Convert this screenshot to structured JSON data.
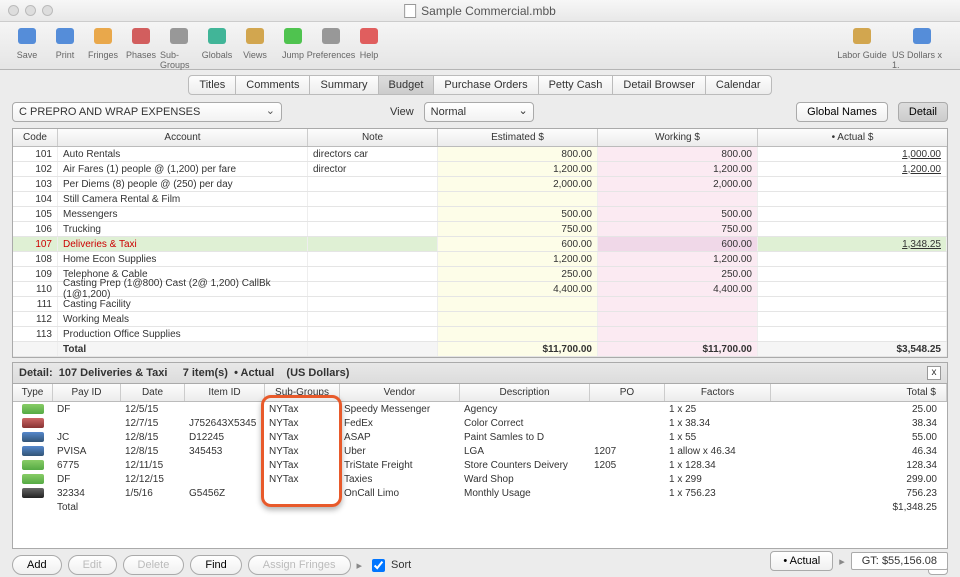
{
  "window": {
    "title": "Sample Commercial.mbb"
  },
  "toolbar": [
    {
      "label": "Save",
      "name": "save"
    },
    {
      "label": "Print",
      "name": "print"
    },
    {
      "label": "Fringes",
      "name": "fringes"
    },
    {
      "label": "Phases",
      "name": "phases"
    },
    {
      "label": "Sub-Groups",
      "name": "subgroups"
    },
    {
      "label": "Globals",
      "name": "globals"
    },
    {
      "label": "Views",
      "name": "views"
    },
    {
      "label": "Jump",
      "name": "jump"
    },
    {
      "label": "Preferences",
      "name": "prefs"
    },
    {
      "label": "Help",
      "name": "help"
    }
  ],
  "toolbar_right": [
    {
      "label": "Labor Guide",
      "name": "laborguide"
    },
    {
      "label": "US Dollars x 1.",
      "name": "currency"
    }
  ],
  "tabs": [
    "Titles",
    "Comments",
    "Summary",
    "Budget",
    "Purchase Orders",
    "Petty Cash",
    "Detail Browser",
    "Calendar"
  ],
  "active_tab": "Budget",
  "category_dropdown": "C  PREPRO AND WRAP EXPENSES",
  "view_label": "View",
  "view_value": "Normal",
  "right_buttons": {
    "global_names": "Global Names",
    "detail": "Detail"
  },
  "columns": {
    "code": "Code",
    "account": "Account",
    "note": "Note",
    "est": "Estimated $",
    "work": "Working $",
    "act": "• Actual $"
  },
  "rows": [
    {
      "code": "101",
      "acct": "Auto Rentals",
      "note": "directors car",
      "est": "800.00",
      "work": "800.00",
      "act": "1,000.00",
      "actU": true
    },
    {
      "code": "102",
      "acct": "Air Fares  (1) people @ (1,200) per fare",
      "note": "director",
      "est": "1,200.00",
      "work": "1,200.00",
      "act": "1,200.00",
      "actU": true
    },
    {
      "code": "103",
      "acct": "Per Diems  (8) people @ (250) per day",
      "note": "",
      "est": "2,000.00",
      "work": "2,000.00",
      "act": ""
    },
    {
      "code": "104",
      "acct": "Still Camera Rental & Film",
      "note": "",
      "est": "",
      "work": "",
      "act": ""
    },
    {
      "code": "105",
      "acct": "Messengers",
      "note": "",
      "est": "500.00",
      "work": "500.00",
      "act": ""
    },
    {
      "code": "106",
      "acct": "Trucking",
      "note": "",
      "est": "750.00",
      "work": "750.00",
      "act": ""
    },
    {
      "code": "107",
      "acct": "Deliveries & Taxi",
      "note": "",
      "est": "600.00",
      "work": "600.00",
      "act": "1,348.25",
      "red": true,
      "sel": true,
      "actU": true
    },
    {
      "code": "108",
      "acct": "Home Econ Supplies",
      "note": "",
      "est": "1,200.00",
      "work": "1,200.00",
      "act": ""
    },
    {
      "code": "109",
      "acct": "Telephone & Cable",
      "note": "",
      "est": "250.00",
      "work": "250.00",
      "act": ""
    },
    {
      "code": "110",
      "acct": "Casting  Prep (1@800)  Cast (2@ 1,200)  CallBk (1@1,200)",
      "note": "",
      "est": "4,400.00",
      "work": "4,400.00",
      "act": ""
    },
    {
      "code": "111",
      "acct": "Casting Facility",
      "note": "",
      "est": "",
      "work": "",
      "act": ""
    },
    {
      "code": "112",
      "acct": "Working Meals",
      "note": "",
      "est": "",
      "work": "",
      "act": ""
    },
    {
      "code": "113",
      "acct": "Production Office Supplies",
      "note": "",
      "est": "",
      "work": "",
      "act": ""
    }
  ],
  "total_row": {
    "label": "Total",
    "est": "$11,700.00",
    "work": "$11,700.00",
    "act": "$3,548.25"
  },
  "detail_header": {
    "prefix": "Detail:",
    "title": "107 Deliveries & Taxi",
    "count": "7 item(s)",
    "mode": "• Actual",
    "curr": "(US Dollars)"
  },
  "detail_cols": {
    "type": "Type",
    "pay": "Pay ID",
    "date": "Date",
    "item": "Item ID",
    "sg": "Sub-Groups",
    "vendor": "Vendor",
    "desc": "Description",
    "po": "PO",
    "fact": "Factors",
    "tot": "Total $"
  },
  "detail_rows": [
    {
      "ti": "g",
      "pay": "DF",
      "date": "12/5/15",
      "item": "",
      "sg": "NYTax",
      "vendor": "Speedy Messenger",
      "desc": "Agency",
      "po": "",
      "fact": "1  x 25",
      "tot": "25.00"
    },
    {
      "ti": "p",
      "pay": "",
      "date": "12/7/15",
      "item": "J752643X5345",
      "sg": "NYTax",
      "vendor": "FedEx",
      "desc": "Color Correct",
      "po": "",
      "fact": "1  x 38.34",
      "tot": "38.34"
    },
    {
      "ti": "b",
      "pay": "JC",
      "date": "12/8/15",
      "item": "D12245",
      "sg": "NYTax",
      "vendor": "ASAP",
      "desc": "Paint Samles to D",
      "po": "",
      "fact": "1  x 55",
      "tot": "55.00"
    },
    {
      "ti": "b",
      "pay": "PVISA",
      "date": "12/8/15",
      "item": "345453",
      "sg": "NYTax",
      "vendor": "Uber",
      "desc": "LGA",
      "po": "1207",
      "fact": "1 allow x 46.34",
      "tot": "46.34"
    },
    {
      "ti": "g",
      "pay": "6775",
      "date": "12/11/15",
      "item": "",
      "sg": "NYTax",
      "vendor": "TriState Freight",
      "desc": "Store Counters Deivery",
      "po": "1205",
      "fact": "1  x 128.34",
      "tot": "128.34"
    },
    {
      "ti": "g",
      "pay": "DF",
      "date": "12/12/15",
      "item": "",
      "sg": "NYTax",
      "vendor": "Taxies",
      "desc": "Ward Shop",
      "po": "",
      "fact": "1  x 299",
      "tot": "299.00"
    },
    {
      "ti": "bk",
      "pay": "32334",
      "date": "1/5/16",
      "item": "G5456Z",
      "sg": "",
      "vendor": "OnCall Limo",
      "desc": "Monthly Usage",
      "po": "",
      "fact": "1  x 756.23",
      "tot": "756.23"
    }
  ],
  "detail_total": {
    "label": "Total",
    "tot": "$1,348.25"
  },
  "detail_buttons": {
    "add": "Add",
    "edit": "Edit",
    "delete": "Delete",
    "find": "Find",
    "assign": "Assign Fringes",
    "sort": "Sort"
  },
  "footer": {
    "actual": "• Actual",
    "expand": "▸",
    "gt_label": "GT:",
    "gt_value": "$55,156.08"
  }
}
